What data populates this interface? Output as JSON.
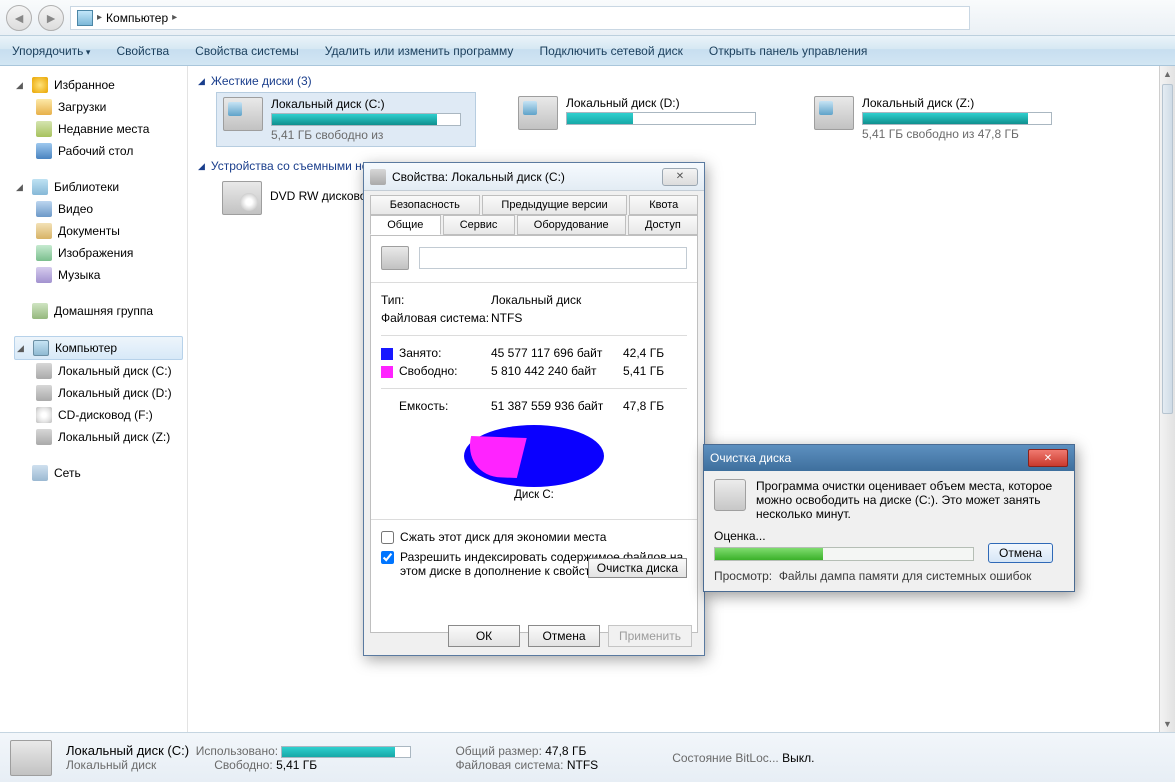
{
  "breadcrumb": {
    "root": "Компьютер"
  },
  "toolbar": {
    "organize": "Упорядочить",
    "properties": "Свойства",
    "sysprops": "Свойства системы",
    "uninstall": "Удалить или изменить программу",
    "mapdrive": "Подключить сетевой диск",
    "controlpanel": "Открыть панель управления"
  },
  "sidebar": {
    "favorites": "Избранное",
    "downloads": "Загрузки",
    "recent": "Недавние места",
    "desktop": "Рабочий стол",
    "libraries": "Библиотеки",
    "video": "Видео",
    "documents": "Документы",
    "images": "Изображения",
    "music": "Музыка",
    "homegroup": "Домашняя группа",
    "computer": "Компьютер",
    "drive_c": "Локальный диск (C:)",
    "drive_d": "Локальный диск (D:)",
    "drive_f": "CD-дисковод (F:)",
    "drive_z": "Локальный диск (Z:)",
    "network": "Сеть"
  },
  "groups": {
    "hdd_label": "Жесткие диски (3)",
    "removable_label": "Устройства со съемными носителями"
  },
  "drives": {
    "c": {
      "name": "Локальный диск (C:)",
      "free_text": "5,41 ГБ свободно из",
      "fill_pct": 88
    },
    "d": {
      "name": "Локальный диск (D:)",
      "fill_pct": 35
    },
    "z": {
      "name": "Локальный диск (Z:)",
      "free_text": "5,41 ГБ свободно из 47,8 ГБ",
      "fill_pct": 88
    },
    "dvd": {
      "name": "DVD RW дисковод (E:)"
    }
  },
  "statusbar": {
    "name": "Локальный диск (C:)",
    "sub": "Локальный диск",
    "used_label": "Использовано:",
    "free_label": "Свободно:",
    "free_val": "5,41 ГБ",
    "total_label": "Общий размер:",
    "total_val": "47,8 ГБ",
    "fs_label": "Файловая система:",
    "fs_val": "NTFS",
    "bitlocker_label": "Состояние BitLoc...",
    "bitlocker_val": "Выкл.",
    "fill_pct": 88
  },
  "props": {
    "title": "Свойства: Локальный диск (C:)",
    "tabs_top": {
      "security": "Безопасность",
      "prev": "Предыдущие версии",
      "quota": "Квота"
    },
    "tabs_bot": {
      "general": "Общие",
      "service": "Сервис",
      "hardware": "Оборудование",
      "access": "Доступ"
    },
    "type_label": "Тип:",
    "type_val": "Локальный диск",
    "fs_label": "Файловая система:",
    "fs_val": "NTFS",
    "used_label": "Занято:",
    "used_bytes": "45 577 117 696 байт",
    "used_gb": "42,4 ГБ",
    "free_label": "Свободно:",
    "free_bytes": "5 810 442 240 байт",
    "free_gb": "5,41 ГБ",
    "cap_label": "Емкость:",
    "cap_bytes": "51 387 559 936 байт",
    "cap_gb": "47,8 ГБ",
    "pie_label": "Диск C:",
    "cleanup_btn": "Очистка диска",
    "compress": "Сжать этот диск для экономии места",
    "index": "Разрешить индексировать содержимое файлов на этом диске в дополнение к свойствам файла",
    "ok": "ОК",
    "cancel": "Отмена",
    "apply": "Применить"
  },
  "cleanup": {
    "title": "Очистка диска",
    "text": "Программа очистки оценивает объем места, которое можно освободить на диске  (C:). Это может занять несколько минут.",
    "eval": "Оценка...",
    "cancel": "Отмена",
    "scan_label": "Просмотр:",
    "scan_val": "Файлы дампа памяти для системных ошибок",
    "progress_pct": 42
  }
}
